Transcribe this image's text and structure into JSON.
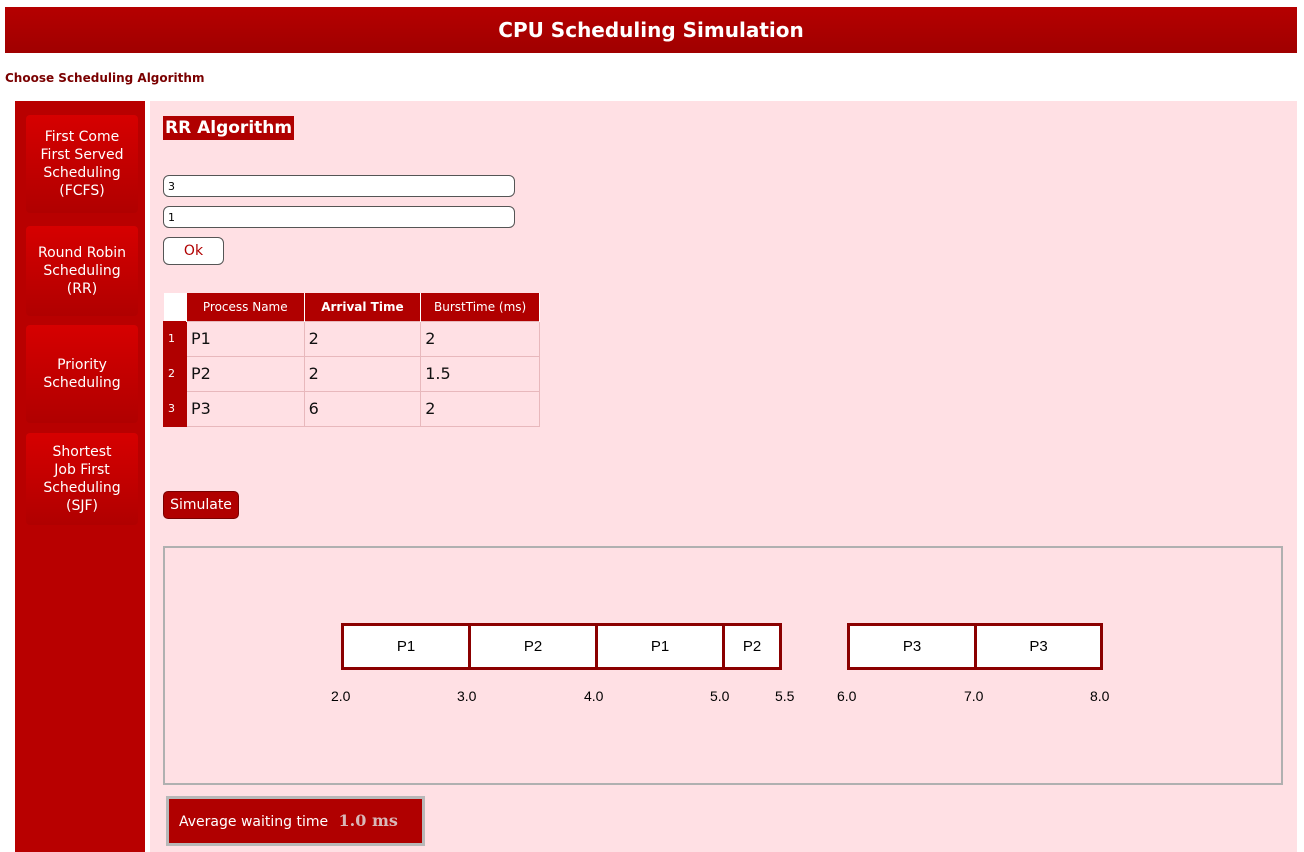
{
  "header": {
    "title": "CPU Scheduling Simulation"
  },
  "choose_label": "Choose Scheduling Algorithm",
  "sidebar": {
    "items": [
      {
        "label_lines": [
          "First Come",
          "First Served",
          "Scheduling",
          "(FCFS)"
        ]
      },
      {
        "label_lines": [
          "Round Robin",
          "Scheduling",
          "(RR)"
        ]
      },
      {
        "label_lines": [
          "Priority",
          "Scheduling"
        ]
      },
      {
        "label_lines": [
          "Shortest",
          "Job First",
          "Scheduling",
          "(SJF)"
        ]
      }
    ]
  },
  "main": {
    "algorithm_title": "RR Algorithm",
    "process_count_value": "3",
    "quantum_value": "1",
    "ok_label": "Ok",
    "table": {
      "headers": [
        "Process Name",
        "Arrival Time",
        "BurstTime (ms)"
      ],
      "rows": [
        {
          "index": "1",
          "name": "P1",
          "arrival": "2",
          "burst": "2"
        },
        {
          "index": "2",
          "name": "P2",
          "arrival": "2",
          "burst": "1.5"
        },
        {
          "index": "3",
          "name": "P3",
          "arrival": "6",
          "burst": "2"
        }
      ]
    },
    "simulate_label": "Simulate",
    "gantt": {
      "blocks": [
        "P1",
        "P2",
        "P1",
        "P2",
        "P3",
        "P3"
      ],
      "ticks": [
        "2.0",
        "3.0",
        "4.0",
        "5.0",
        "5.5",
        "6.0",
        "7.0",
        "8.0"
      ]
    },
    "average": {
      "label": "Average waiting time",
      "value": "1.0 ms"
    }
  },
  "colors": {
    "accent": "#b00000",
    "panel": "#ffe0e4",
    "bar_border": "#8b0000"
  }
}
